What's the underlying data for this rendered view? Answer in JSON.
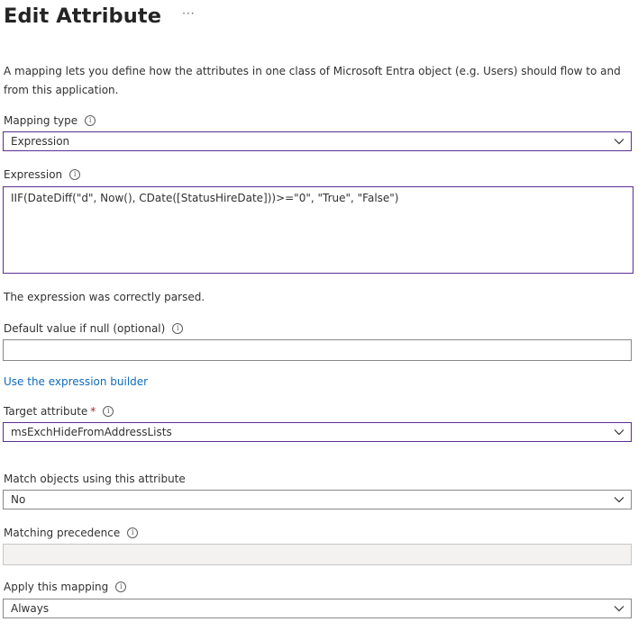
{
  "header": {
    "title": "Edit Attribute",
    "more_label": "···"
  },
  "description": "A mapping lets you define how the attributes in one class of Microsoft Entra object (e.g. Users) should flow to and from this application.",
  "mapping_type": {
    "label": "Mapping type",
    "value": "Expression"
  },
  "expression": {
    "label": "Expression",
    "value": "IIF(DateDiff(\"d\", Now(), CDate([StatusHireDate]))>=\"0\", \"True\", \"False\")",
    "status": "The expression was correctly parsed."
  },
  "default_value": {
    "label": "Default value if null (optional)",
    "value": ""
  },
  "expression_builder_link": "Use the expression builder",
  "target_attribute": {
    "label": "Target attribute",
    "required_marker": "*",
    "value": "msExchHideFromAddressLists"
  },
  "match_objects": {
    "label": "Match objects using this attribute",
    "value": "No"
  },
  "matching_precedence": {
    "label": "Matching precedence",
    "value": ""
  },
  "apply_mapping": {
    "label": "Apply this mapping",
    "value": "Always"
  },
  "colors": {
    "focus_border": "#5c2e91",
    "link": "#0f6cbd",
    "required": "#a4262c",
    "disabled_bg": "#f3f2f1"
  }
}
